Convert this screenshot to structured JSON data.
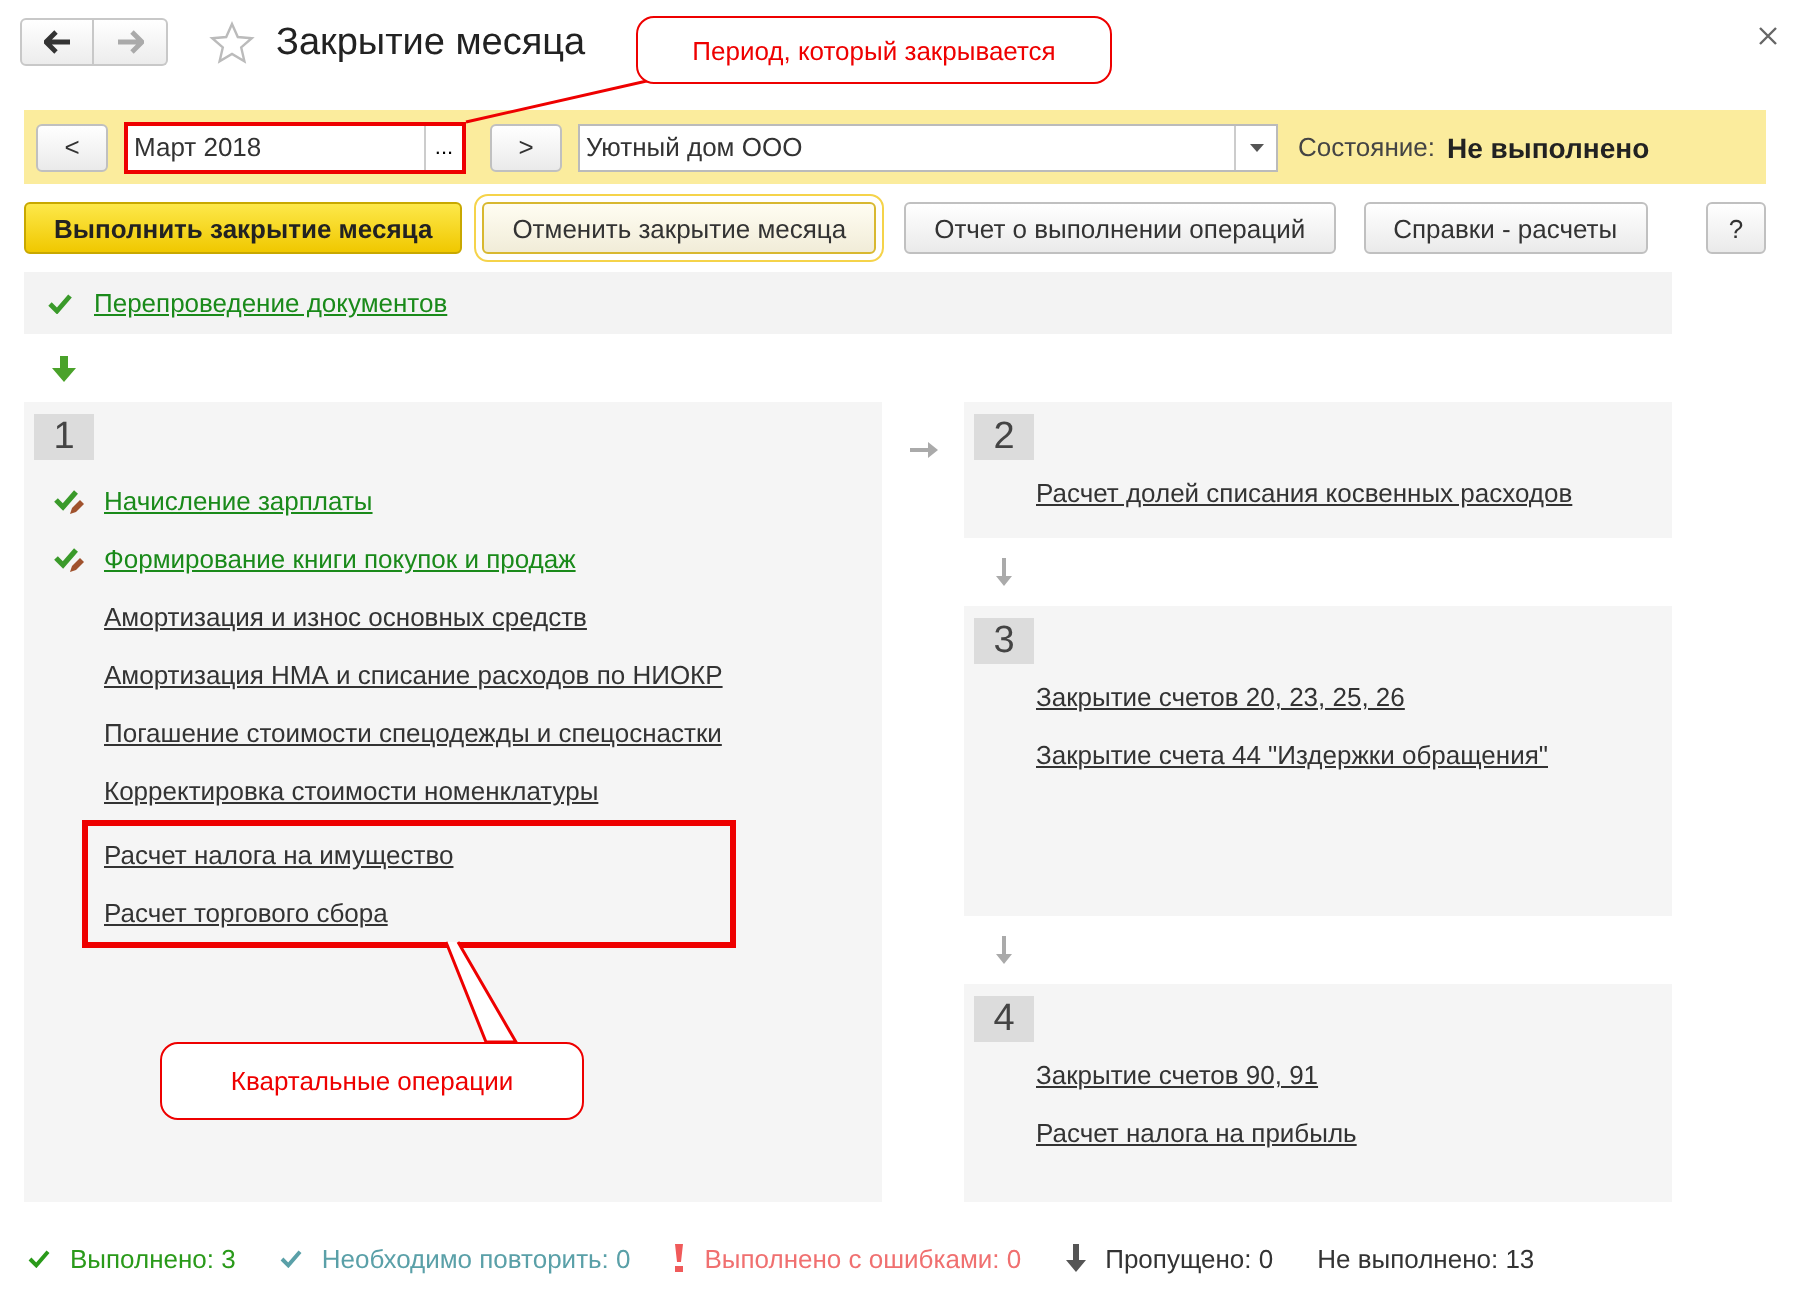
{
  "window": {
    "title": "Закрытие месяца",
    "starred": false
  },
  "toolbar": {
    "prev": "<",
    "period": "Март 2018",
    "period_picker": "...",
    "period_highlighted": true,
    "next": ">",
    "organization": "Уютный дом ООО",
    "state_label": "Состояние:",
    "state_value": "Не выполнено"
  },
  "buttons": [
    {
      "label": "Выполнить закрытие месяца",
      "primary": true,
      "focused": false
    },
    {
      "label": "Отменить закрытие месяца",
      "primary": false,
      "focused": true
    },
    {
      "label": "Отчет о выполнении операций",
      "primary": false,
      "focused": false
    },
    {
      "label": "Справки - расчеты",
      "primary": false,
      "focused": false
    }
  ],
  "help_button": "?",
  "prelude": {
    "label": "Перепроведение документов",
    "kind": "done"
  },
  "stages": [
    {
      "number": "1",
      "operations": [
        {
          "label": "Начисление зарплаты",
          "kind": "edited"
        },
        {
          "label": "Формирование книги покупок и продаж",
          "kind": "edited"
        },
        {
          "label": "Амортизация и износ основных средств",
          "kind": "pending"
        },
        {
          "label": "Амортизация НМА и списание расходов по НИОКР",
          "kind": "pending"
        },
        {
          "label": "Погашение стоимости спецодежды и спецоснастки",
          "kind": "pending"
        },
        {
          "label": "Корректировка стоимости номенклатуры",
          "kind": "pending"
        }
      ],
      "framed_operations": [
        {
          "label": "Расчет налога на имущество",
          "kind": "pending"
        },
        {
          "label": "Расчет торгового сбора",
          "kind": "pending"
        }
      ]
    },
    {
      "number": "2",
      "operations": [
        {
          "label": "Расчет долей списания косвенных расходов",
          "kind": "pending"
        }
      ]
    },
    {
      "number": "3",
      "operations": [
        {
          "label": "Закрытие счетов 20, 23, 25, 26",
          "kind": "pending"
        },
        {
          "label": "Закрытие счета 44 \"Издержки обращения\"",
          "kind": "pending"
        }
      ]
    },
    {
      "number": "4",
      "operations": [
        {
          "label": "Закрытие счетов 90, 91",
          "kind": "pending"
        },
        {
          "label": "Расчет налога на прибыль",
          "kind": "pending"
        }
      ]
    }
  ],
  "status_bar": [
    {
      "kind": "done",
      "text": "Выполнено: 3"
    },
    {
      "kind": "repeat",
      "text": "Необходимо повторить: 0"
    },
    {
      "kind": "error",
      "text": "Выполнено с ошибками: 0"
    },
    {
      "kind": "skipped",
      "text": "Пропущено: 0"
    },
    {
      "kind": "pending",
      "text": "Не выполнено: 13"
    }
  ],
  "annotations": [
    {
      "text": "Период, который закрывается"
    },
    {
      "text": "Квартальные операции"
    }
  ]
}
